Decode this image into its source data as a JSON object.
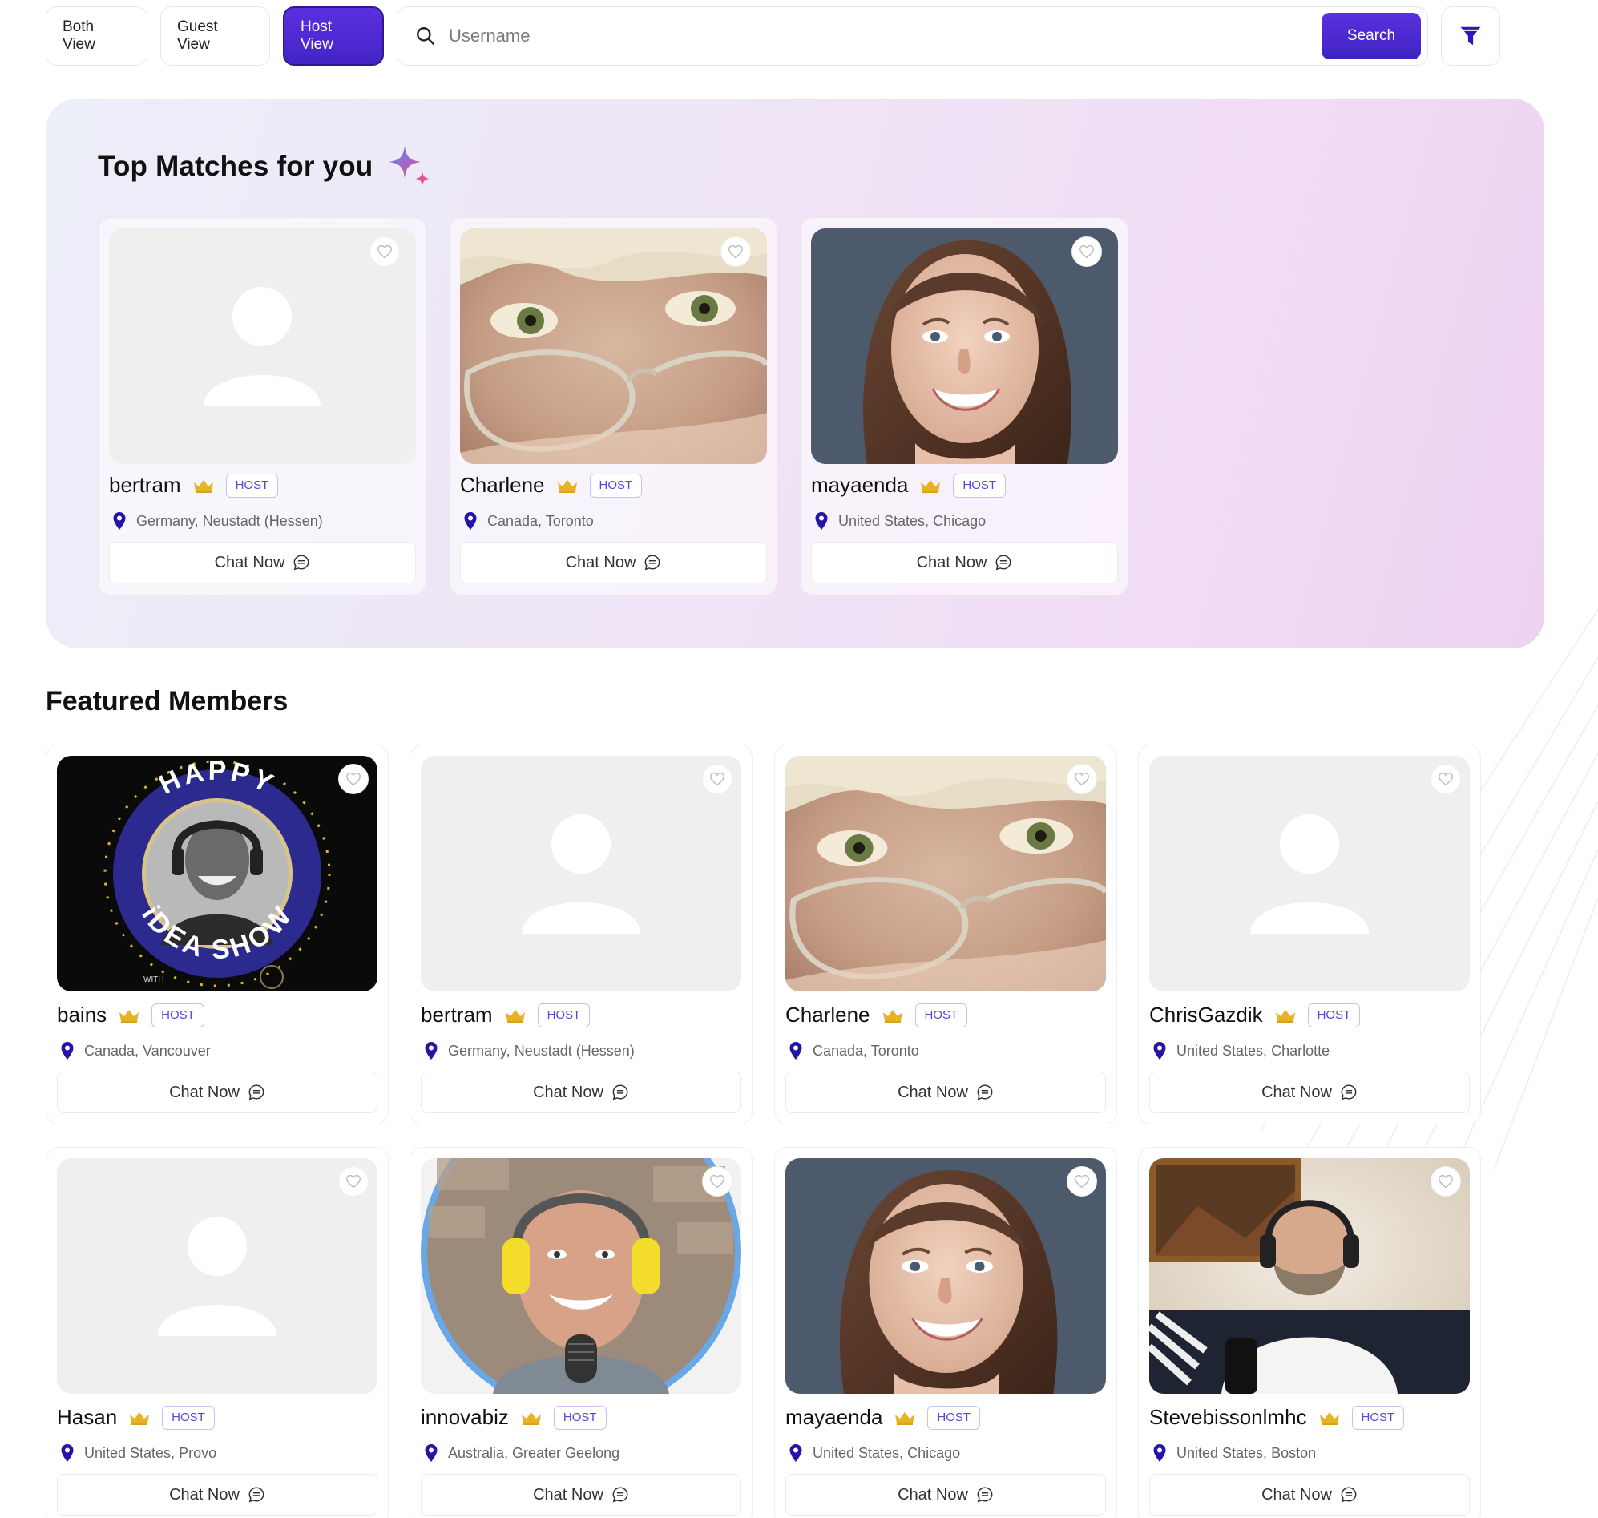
{
  "toolbar": {
    "views": [
      "Both View",
      "Guest View",
      "Host View"
    ],
    "active_view": "Host View",
    "search_placeholder": "Username",
    "search_label": "Search"
  },
  "top_matches": {
    "title": "Top Matches for you",
    "cards": [
      {
        "name": "bertram",
        "badge": "HOST",
        "location": "Germany, Neustadt (Hessen)",
        "chat": "Chat Now",
        "photo": "placeholder-avatar"
      },
      {
        "name": "Charlene",
        "badge": "HOST",
        "location": "Canada, Toronto",
        "chat": "Chat Now",
        "photo": "eyes-glasses-photo"
      },
      {
        "name": "mayaenda",
        "badge": "HOST",
        "location": "United States, Chicago",
        "chat": "Chat Now",
        "photo": "smiling-woman-photo"
      }
    ]
  },
  "featured": {
    "title": "Featured Members",
    "cards": [
      {
        "name": "bains",
        "badge": "HOST",
        "location": "Canada, Vancouver",
        "chat": "Chat Now",
        "photo": "happy-idea-show-logo",
        "logo_text_top": "HAPPY",
        "logo_text_bottom": "iDEA SHOW",
        "logo_small": "WITH"
      },
      {
        "name": "bertram",
        "badge": "HOST",
        "location": "Germany, Neustadt (Hessen)",
        "chat": "Chat Now",
        "photo": "placeholder-avatar"
      },
      {
        "name": "Charlene",
        "badge": "HOST",
        "location": "Canada, Toronto",
        "chat": "Chat Now",
        "photo": "eyes-glasses-photo"
      },
      {
        "name": "ChrisGazdik",
        "badge": "HOST",
        "location": "United States, Charlotte",
        "chat": "Chat Now",
        "photo": "placeholder-avatar"
      },
      {
        "name": "Hasan",
        "badge": "HOST",
        "location": "United States, Provo",
        "chat": "Chat Now",
        "photo": "placeholder-avatar"
      },
      {
        "name": "innovabiz",
        "badge": "HOST",
        "location": "Australia, Greater Geelong",
        "chat": "Chat Now",
        "photo": "man-headphones-circle-photo"
      },
      {
        "name": "mayaenda",
        "badge": "HOST",
        "location": "United States, Chicago",
        "chat": "Chat Now",
        "photo": "smiling-woman-photo"
      },
      {
        "name": "Stevebissonlmhc",
        "badge": "HOST",
        "location": "United States, Boston",
        "chat": "Chat Now",
        "photo": "bearded-man-headphones-photo"
      }
    ]
  },
  "colors": {
    "accent": "#4a2bd0",
    "pin": "#2414a8",
    "crown": "#e6b325",
    "badge_border": "#c9c0f2"
  }
}
